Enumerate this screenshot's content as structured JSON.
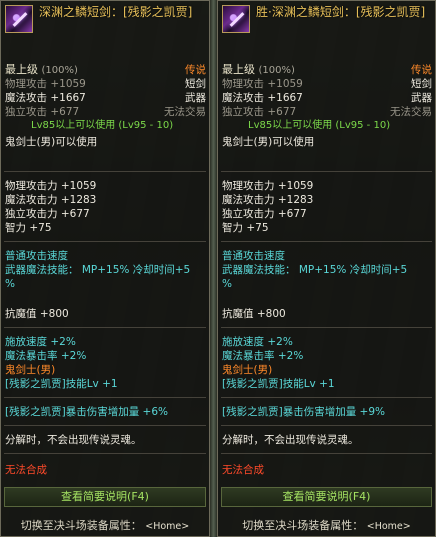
{
  "left": {
    "name": "深渊之鳞短剑：[残影之凯贾]",
    "grade_label": "最上级",
    "grade_pct": "(100%)",
    "rarity": "传说",
    "item_type": "短剑",
    "slot": "武器",
    "trade": "无法交易",
    "phys_atk_dim": "物理攻击 +1059",
    "mag_atk": "魔法攻击 +1667",
    "indep_atk_dim": "独立攻击 +677",
    "level_req": "Lv85以上可以使用 (Lv95 - 10)",
    "class_req": "鬼剑士(男)可以使用",
    "stat_phys": "物理攻击力 +1059",
    "stat_mag": "魔法攻击力 +1283",
    "stat_indep": "独立攻击力 +677",
    "stat_int": "智力 +75",
    "atk_speed": "普通攻击速度",
    "weapon_skill": "武器魔法技能： MP+15% 冷却时间+5",
    "weapon_skill_pct": "%",
    "magic_res": "抗魔值 +800",
    "cast_speed": "施放速度 +2%",
    "mag_crit": "魔法暴击率 +2%",
    "class_tag": "鬼剑士(男)",
    "skill_lv": "[残影之凯贾]技能Lv +1",
    "crit_dmg": "[残影之凯贾]暴击伤害增加量 +6%",
    "disassemble": "分解时，不会出现传说灵魂。",
    "no_combine": "无法合成",
    "view_btn": "查看简要说明(F4)",
    "switch_label": "切换至决斗场装备属性：",
    "home_key": "<Home>"
  },
  "right": {
    "name": "胜·深渊之鳞短剑：[残影之凯贾]",
    "grade_label": "最上级",
    "grade_pct": "(100%)",
    "rarity": "传说",
    "item_type": "短剑",
    "slot": "武器",
    "trade": "无法交易",
    "phys_atk_dim": "物理攻击 +1059",
    "mag_atk": "魔法攻击 +1667",
    "indep_atk_dim": "独立攻击 +677",
    "level_req": "Lv85以上可以使用 (Lv95 - 10)",
    "class_req": "鬼剑士(男)可以使用",
    "stat_phys": "物理攻击力 +1059",
    "stat_mag": "魔法攻击力 +1283",
    "stat_indep": "独立攻击力 +677",
    "stat_int": "智力 +75",
    "atk_speed": "普通攻击速度",
    "weapon_skill": "武器魔法技能： MP+15% 冷却时间+5",
    "weapon_skill_pct": "%",
    "magic_res": "抗魔值 +800",
    "cast_speed": "施放速度 +2%",
    "mag_crit": "魔法暴击率 +2%",
    "class_tag": "鬼剑士(男)",
    "skill_lv": "[残影之凯贾]技能Lv +1",
    "crit_dmg": "[残影之凯贾]暴击伤害增加量 +9%",
    "disassemble": "分解时，不会出现传说灵魂。",
    "no_combine": "无法合成",
    "view_btn": "查看简要说明(F4)",
    "switch_label": "切换至决斗场装备属性：",
    "home_key": "<Home>"
  },
  "colors": {
    "name": "#e8c15a",
    "rarity": "#ff8a2a",
    "green": "#7cd94a",
    "cyan": "#5ad8d8",
    "red": "#ff4a2a"
  },
  "icons": {
    "item": "dagger-item-icon"
  }
}
